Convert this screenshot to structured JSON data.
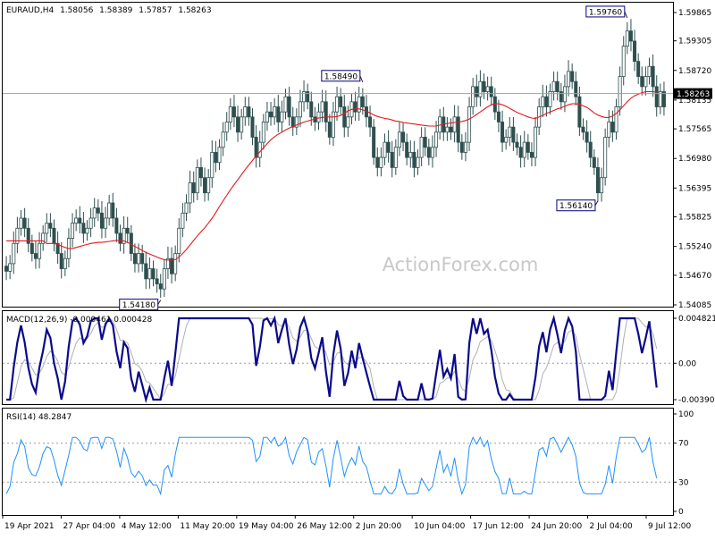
{
  "chart_data": {
    "type": "candlestick",
    "symbol_header": "EURAUD,H4",
    "ohlc": [
      "1.58056",
      "1.58389",
      "1.57857",
      "1.58263"
    ],
    "watermark": "ActionForex.com",
    "last_price": "1.58263",
    "price_axis": {
      "ticks": [
        "1.59865",
        "1.59305",
        "1.58720",
        "1.58135",
        "1.57565",
        "1.56980",
        "1.56395",
        "1.55825",
        "1.55240",
        "1.54670",
        "1.54085"
      ],
      "ylim": [
        1.54085,
        1.59865
      ]
    },
    "annotations": [
      {
        "label": "1.58490",
        "value": 1.5849,
        "bar": 97
      },
      {
        "label": "1.59760",
        "value": 1.5976,
        "bar": 169
      },
      {
        "label": "1.56140",
        "value": 1.5614,
        "bar": 161
      },
      {
        "label": "1.54180",
        "value": 1.5418,
        "bar": 42
      }
    ],
    "price_series": [
      1.5475,
      1.549,
      1.553,
      1.556,
      1.558,
      1.556,
      1.553,
      1.551,
      1.55,
      1.553,
      1.555,
      1.557,
      1.556,
      1.553,
      1.551,
      1.548,
      1.55,
      1.554,
      1.557,
      1.558,
      1.557,
      1.555,
      1.556,
      1.558,
      1.56,
      1.559,
      1.556,
      1.558,
      1.561,
      1.558,
      1.555,
      1.553,
      1.556,
      1.555,
      1.551,
      1.549,
      1.551,
      1.549,
      1.546,
      1.548,
      1.546,
      1.545,
      1.544,
      1.548,
      1.55,
      1.547,
      1.551,
      1.556,
      1.559,
      1.561,
      1.565,
      1.563,
      1.568,
      1.566,
      1.563,
      1.566,
      1.571,
      1.569,
      1.572,
      1.575,
      1.577,
      1.58,
      1.578,
      1.575,
      1.578,
      1.58,
      1.578,
      1.574,
      1.57,
      1.573,
      1.577,
      1.579,
      1.578,
      1.58,
      1.577,
      1.579,
      1.582,
      1.578,
      1.576,
      1.578,
      1.581,
      1.583,
      1.581,
      1.578,
      1.577,
      1.579,
      1.581,
      1.577,
      1.574,
      1.579,
      1.582,
      1.58,
      1.576,
      1.578,
      1.581,
      1.579,
      1.582,
      1.58,
      1.578,
      1.576,
      1.57,
      1.568,
      1.57,
      1.573,
      1.571,
      1.568,
      1.572,
      1.575,
      1.573,
      1.57,
      1.571,
      1.568,
      1.57,
      1.574,
      1.572,
      1.57,
      1.572,
      1.575,
      1.578,
      1.575,
      1.576,
      1.575,
      1.578,
      1.573,
      1.571,
      1.573,
      1.58,
      1.584,
      1.582,
      1.585,
      1.583,
      1.584,
      1.582,
      1.579,
      1.577,
      1.573,
      1.574,
      1.576,
      1.573,
      1.572,
      1.57,
      1.573,
      1.571,
      1.57,
      1.576,
      1.58,
      1.582,
      1.58,
      1.583,
      1.585,
      1.583,
      1.581,
      1.584,
      1.587,
      1.585,
      1.582,
      1.576,
      1.575,
      1.573,
      1.57,
      1.568,
      1.563,
      1.566,
      1.574,
      1.577,
      1.575,
      1.58,
      1.586,
      1.592,
      1.595,
      1.593,
      1.589,
      1.586,
      1.584,
      1.586,
      1.588,
      1.584,
      1.58,
      1.583,
      1.58
    ],
    "ema_series": [
      1.5535,
      1.5535,
      1.5535,
      1.5535,
      1.5535,
      1.5535,
      1.5535,
      1.5535,
      1.5535,
      1.5535,
      1.5535,
      1.553,
      1.553,
      1.553,
      1.5528,
      1.5525,
      1.5522,
      1.552,
      1.552,
      1.5522,
      1.5524,
      1.5526,
      1.5528,
      1.553,
      1.5531,
      1.5532,
      1.5532,
      1.5533,
      1.5534,
      1.5535,
      1.5536,
      1.5536,
      1.5535,
      1.5532,
      1.5528,
      1.5524,
      1.552,
      1.5516,
      1.5512,
      1.5509,
      1.5506,
      1.5503,
      1.55,
      1.5498,
      1.5497,
      1.5497,
      1.5498,
      1.5503,
      1.551,
      1.5518,
      1.5527,
      1.5536,
      1.5545,
      1.5553,
      1.5561,
      1.557,
      1.558,
      1.5591,
      1.5603,
      1.5614,
      1.5625,
      1.5636,
      1.5646,
      1.5656,
      1.5666,
      1.5676,
      1.5685,
      1.5694,
      1.5703,
      1.5711,
      1.5719,
      1.5727,
      1.5735,
      1.5741,
      1.5746,
      1.575,
      1.5754,
      1.5758,
      1.5761,
      1.5764,
      1.5767,
      1.577,
      1.5772,
      1.5774,
      1.5776,
      1.5778,
      1.5779,
      1.578,
      1.578,
      1.578,
      1.5781,
      1.5783,
      1.5787,
      1.5792,
      1.5795,
      1.5796,
      1.5796,
      1.5794,
      1.5791,
      1.5788,
      1.5784,
      1.5781,
      1.5779,
      1.5777,
      1.5776,
      1.5774,
      1.5772,
      1.5771,
      1.5769,
      1.5768,
      1.5767,
      1.5766,
      1.5765,
      1.5764,
      1.5763,
      1.5762,
      1.5762,
      1.5762,
      1.5764,
      1.5766,
      1.5767,
      1.5768,
      1.5769,
      1.577,
      1.5771,
      1.5773,
      1.5776,
      1.578,
      1.5785,
      1.579,
      1.5795,
      1.58,
      1.5804,
      1.5806,
      1.5806,
      1.5804,
      1.5801,
      1.5797,
      1.5793,
      1.5789,
      1.5786,
      1.5783,
      1.578,
      1.5778,
      1.5777,
      1.578,
      1.5783,
      1.5787,
      1.579,
      1.5793,
      1.5796,
      1.5798,
      1.5801,
      1.5804,
      1.5806,
      1.5806,
      1.5805,
      1.5802,
      1.5799,
      1.5794,
      1.5788,
      1.5784,
      1.5781,
      1.5779,
      1.5779,
      1.5782,
      1.5787,
      1.5794,
      1.5802,
      1.581,
      1.5817,
      1.5822,
      1.5825,
      1.5828,
      1.583,
      1.583,
      1.583,
      1.5829
    ],
    "macd_panel": {
      "label": "MACD(12,26,9) -0.000461 0.000428",
      "ticks": [
        "0.004821",
        "0.00",
        "-0.003905"
      ],
      "ylim": [
        -0.003905,
        0.004821
      ]
    },
    "rsi_panel": {
      "label": "RSI(14) 48.2847",
      "ticks": [
        "100",
        "70",
        "30",
        "0"
      ],
      "levels": [
        70,
        30
      ],
      "ylim": [
        0,
        100
      ]
    },
    "time_axis": [
      "19 Apr 2021",
      "27 Apr 04:00",
      "4 May 12:00",
      "11 May 20:00",
      "19 May 04:00",
      "26 May 12:00",
      "2 Jun 20:00",
      "10 Jun 04:00",
      "17 Jun 12:00",
      "24 Jun 20:00",
      "2 Jul 04:00",
      "9 Jul 12:00"
    ],
    "colors": {
      "candles": "#2f4f4f",
      "ema": "#e31a1c",
      "macd": "#0a0a8c",
      "signal": "#b0b0b0",
      "rsi": "#1e90ff",
      "grid": "#9a9a9a"
    }
  }
}
